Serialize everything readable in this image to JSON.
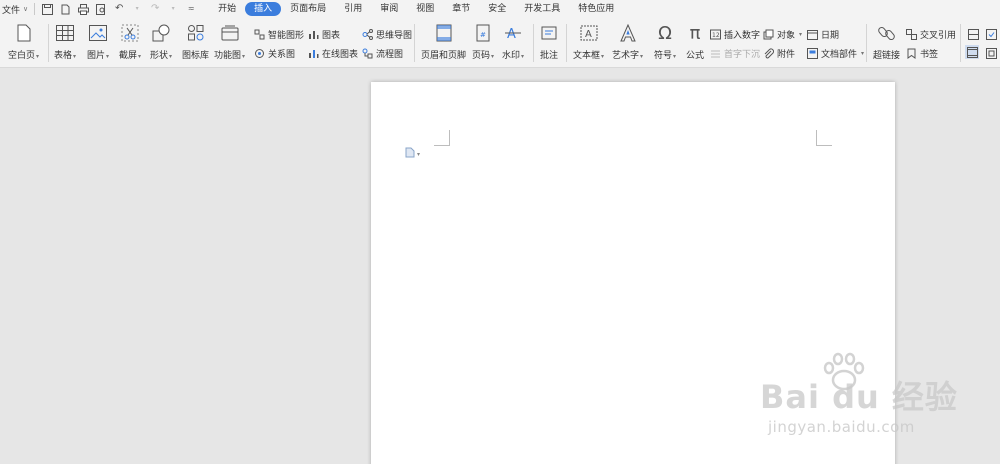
{
  "menubar": {
    "file_label": "文件",
    "tabs": [
      {
        "label": "开始",
        "active": false
      },
      {
        "label": "插入",
        "active": true
      },
      {
        "label": "页面布局",
        "active": false
      },
      {
        "label": "引用",
        "active": false
      },
      {
        "label": "审阅",
        "active": false
      },
      {
        "label": "视图",
        "active": false
      },
      {
        "label": "章节",
        "active": false
      },
      {
        "label": "安全",
        "active": false
      },
      {
        "label": "开发工具",
        "active": false
      },
      {
        "label": "特色应用",
        "active": false
      }
    ],
    "accent": "#3b7ddd"
  },
  "ribbon": {
    "blank_page": "空白页",
    "table": "表格",
    "picture": "图片",
    "screenshot": "截屏",
    "shape": "形状",
    "icon_library": "图标库",
    "function_chart": "功能图",
    "smart_graphic": "智能图形",
    "chart": "图表",
    "mind_map": "思维导图",
    "relation_chart": "关系图",
    "online_chart": "在线图表",
    "flowchart": "流程图",
    "header_footer": "页眉和页脚",
    "page_number": "页码",
    "watermark": "水印",
    "comment": "批注",
    "text_box": "文本框",
    "art_text": "艺术字",
    "symbol": "符号",
    "formula": "公式",
    "insert_number": "插入数字",
    "drop_cap": "首字下沉",
    "object": "对象",
    "attachment": "附件",
    "date": "日期",
    "document_part": "文档部件",
    "hyperlink": "超链接",
    "cross_reference": "交叉引用",
    "bookmark": "书签"
  },
  "watermark": {
    "brand": "Bai du 经验",
    "url": "jingyan.baidu.com"
  }
}
